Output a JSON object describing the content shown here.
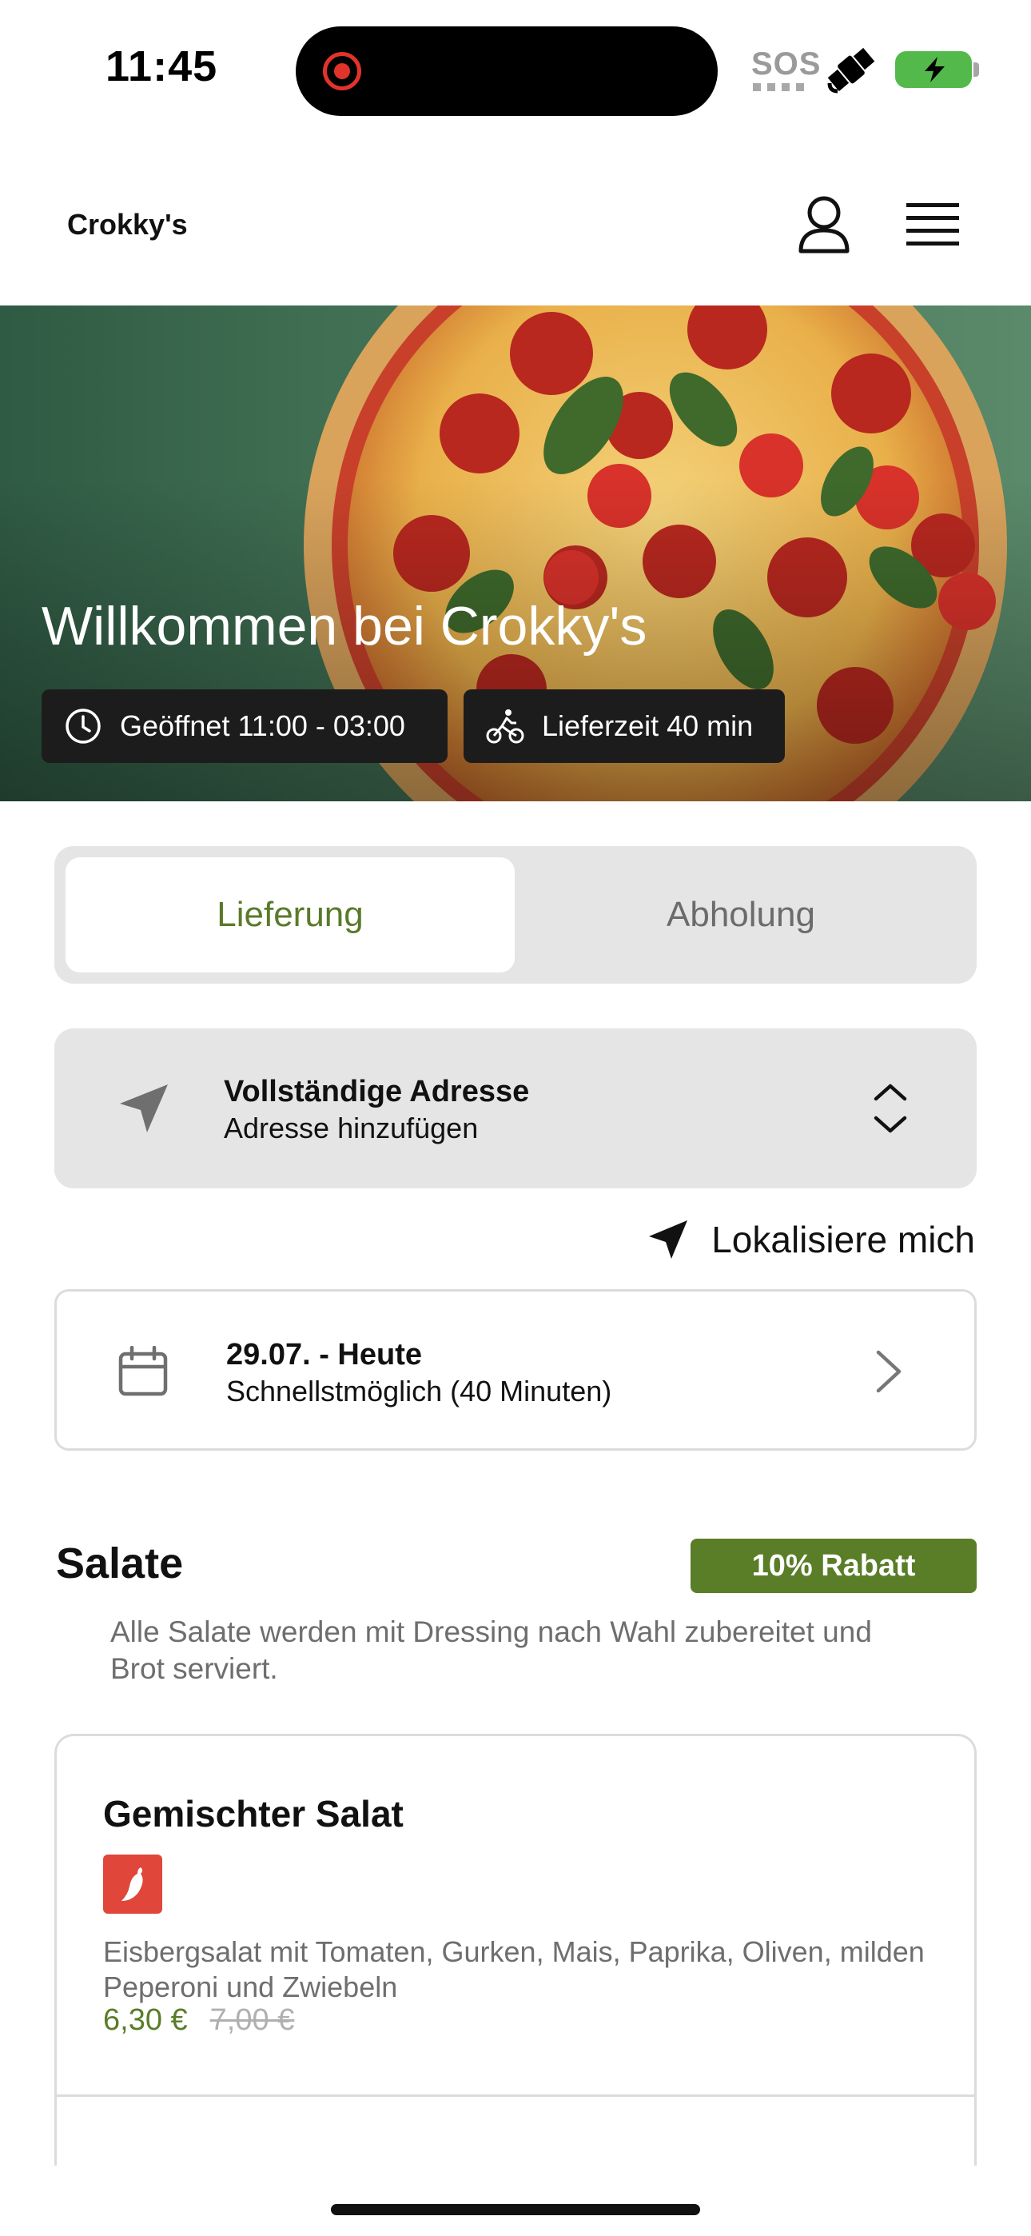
{
  "status_bar": {
    "time": "11:45",
    "sos": "SOS",
    "icons": [
      "screen-recording-icon",
      "satellite-icon",
      "battery-charging-icon"
    ],
    "recording_color": "#e2332b",
    "battery_color": "#54b94b"
  },
  "header": {
    "brand": "Crokky's",
    "icons": [
      "user-icon",
      "menu-icon"
    ]
  },
  "hero": {
    "title": "Willkommen bei Crokky's",
    "opening_hours": "Geöffnet 11:00 - 03:00",
    "delivery_time": "Lieferzeit 40 min",
    "icons": [
      "clock-icon",
      "cyclist-icon"
    ]
  },
  "order_mode": {
    "tabs": [
      {
        "label": "Lieferung",
        "selected": true
      },
      {
        "label": "Abholung",
        "selected": false
      }
    ],
    "accent": "#5a7a2a"
  },
  "address": {
    "title": "Vollständige Adresse",
    "subtitle": "Adresse hinzufügen",
    "locate_label": "Lokalisiere mich"
  },
  "schedule": {
    "date": "29.07. - Heute",
    "time": "Schnellstmöglich (40 Minuten)"
  },
  "section": {
    "title": "Salate",
    "discount": "10% Rabatt",
    "description": "Alle Salate werden mit Dressing nach Wahl zubereitet und Brot serviert.",
    "discount_color": "#5a7d28"
  },
  "product": {
    "name": "Gemischter Salat",
    "badge_icon": "chili-icon",
    "description": "Eisbergsalat mit Tomaten, Gurken, Mais, Paprika, Oliven, milden Peperoni und Zwiebeln",
    "price": "6,30 €",
    "old_price": "7,00 €"
  }
}
